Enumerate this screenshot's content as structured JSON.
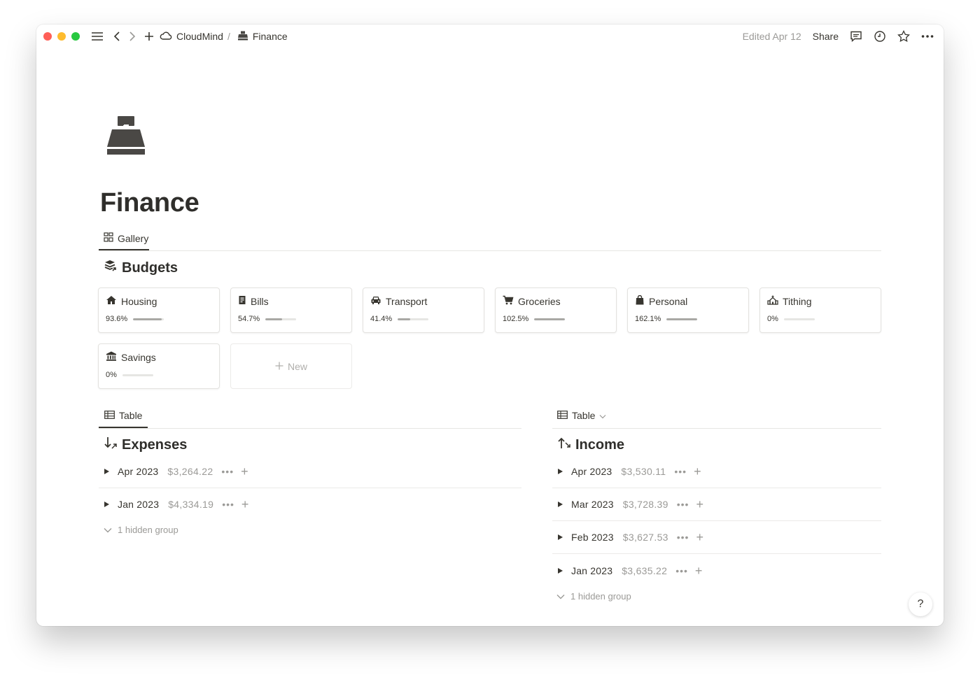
{
  "topbar": {
    "workspace": "CloudMind",
    "separator": "/",
    "page": "Finance",
    "edited": "Edited Apr 12",
    "share": "Share"
  },
  "page": {
    "title": "Finance"
  },
  "gallery_view": {
    "tab_label": "Gallery",
    "section_title": "Budgets",
    "cards": [
      {
        "name": "Housing",
        "percent": "93.6%",
        "progress": 0.936,
        "icon": "house-icon"
      },
      {
        "name": "Bills",
        "percent": "54.7%",
        "progress": 0.547,
        "icon": "receipt-icon"
      },
      {
        "name": "Transport",
        "percent": "41.4%",
        "progress": 0.414,
        "icon": "car-icon"
      },
      {
        "name": "Groceries",
        "percent": "102.5%",
        "progress": 1.0,
        "icon": "cart-icon"
      },
      {
        "name": "Personal",
        "percent": "162.1%",
        "progress": 1.0,
        "icon": "bag-icon"
      },
      {
        "name": "Tithing",
        "percent": "0%",
        "progress": 0,
        "icon": "church-icon"
      },
      {
        "name": "Savings",
        "percent": "0%",
        "progress": 0,
        "icon": "bank-icon"
      }
    ],
    "new_label": "New"
  },
  "expenses": {
    "tab_label": "Table",
    "section_title": "Expenses",
    "groups": [
      {
        "label": "Apr 2023",
        "amount": "$3,264.22"
      },
      {
        "label": "Jan 2023",
        "amount": "$4,334.19"
      }
    ],
    "hidden_label": "1 hidden group"
  },
  "income": {
    "tab_label": "Table",
    "section_title": "Income",
    "groups": [
      {
        "label": "Apr 2023",
        "amount": "$3,530.11"
      },
      {
        "label": "Mar 2023",
        "amount": "$3,728.39"
      },
      {
        "label": "Feb 2023",
        "amount": "$3,627.53"
      },
      {
        "label": "Jan 2023",
        "amount": "$3,635.22"
      }
    ],
    "hidden_label": "1 hidden group"
  },
  "help": {
    "label": "?"
  },
  "colors": {
    "accent": "#37352f",
    "muted": "#9b9a97",
    "close": "#ff5f57",
    "minimize": "#febc2e",
    "zoom": "#28c840"
  }
}
